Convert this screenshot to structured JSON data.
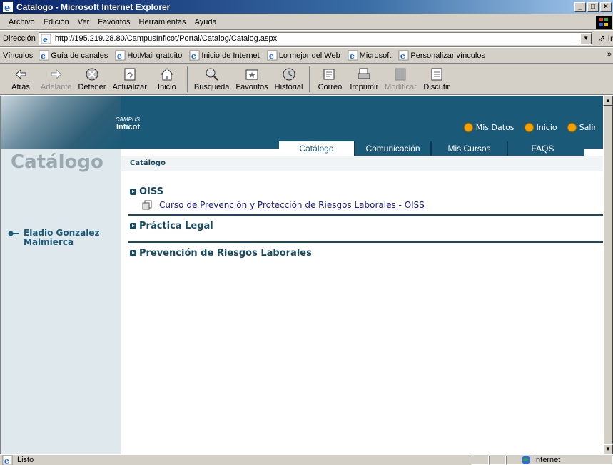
{
  "window": {
    "title": "Catalogo - Microsoft Internet Explorer"
  },
  "menu": [
    "Archivo",
    "Edición",
    "Ver",
    "Favoritos",
    "Herramientas",
    "Ayuda"
  ],
  "address": {
    "label": "Dirección",
    "url": "http://195.219.28.80/CampusInficot/Portal/Catalog/Catalog.aspx",
    "go": "Ir"
  },
  "links": {
    "label": "Vínculos",
    "items": [
      "Guía de canales",
      "HotMail gratuito",
      "Inicio de Internet",
      "Lo mejor del Web",
      "Microsoft",
      "Personalizar vínculos"
    ]
  },
  "toolbar": [
    {
      "label": "Atrás",
      "icon": "back-arrow-icon",
      "disabled": false
    },
    {
      "label": "Adelante",
      "icon": "forward-arrow-icon",
      "disabled": true
    },
    {
      "label": "Detener",
      "icon": "stop-icon",
      "disabled": false
    },
    {
      "label": "Actualizar",
      "icon": "refresh-icon",
      "disabled": false
    },
    {
      "label": "Inicio",
      "icon": "home-icon",
      "disabled": false
    },
    {
      "label": "Búsqueda",
      "icon": "search-icon",
      "disabled": false
    },
    {
      "label": "Favoritos",
      "icon": "favorites-icon",
      "disabled": false
    },
    {
      "label": "Historial",
      "icon": "history-icon",
      "disabled": false
    },
    {
      "label": "Correo",
      "icon": "mail-icon",
      "disabled": false
    },
    {
      "label": "Imprimir",
      "icon": "print-icon",
      "disabled": false
    },
    {
      "label": "Modificar",
      "icon": "edit-icon",
      "disabled": true
    },
    {
      "label": "Discutir",
      "icon": "discuss-icon",
      "disabled": false
    }
  ],
  "portal": {
    "brand_top": "CAMPUS",
    "brand_name": "Inficot",
    "top_links": [
      "Mis Datos",
      "Inicio",
      "Salir"
    ],
    "tabs": [
      "Catálogo",
      "Comunicación",
      "Mis Cursos",
      "FAQS"
    ],
    "active_tab": "Catálogo",
    "breadcrumb": "Catálogo",
    "sidebar_title": "Catálogo",
    "user_name_line1": "Eladio Gonzalez",
    "user_name_line2": "Malmierca",
    "sections": [
      {
        "title": "OISS",
        "courses": [
          "Curso de Prevención y Protección de Riesgos Laborales - OISS"
        ]
      },
      {
        "title": "Práctica Legal",
        "courses": []
      },
      {
        "title": "Prevención de Riesgos Laborales",
        "courses": []
      }
    ]
  },
  "status": {
    "text": "Listo",
    "zone": "Internet"
  },
  "colors": {
    "portal_blue": "#1a5a78",
    "sidebar_bg": "#dfe8ec",
    "chrome": "#d4d0c8"
  }
}
